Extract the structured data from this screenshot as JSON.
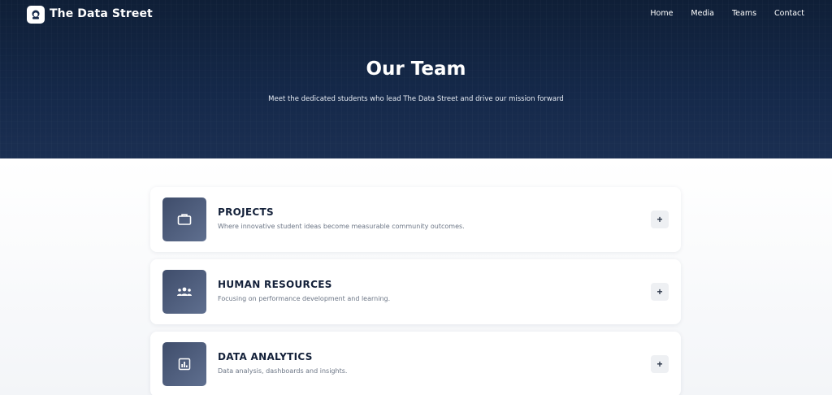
{
  "nav": {
    "brand": "The Data Street",
    "logo_icon": "logo-mascot-icon",
    "links": [
      "Home",
      "Media",
      "Teams",
      "Contact"
    ]
  },
  "hero": {
    "title": "Our Team",
    "subtitle": "Meet the dedicated students who lead The Data Street and drive our mission forward"
  },
  "teams": [
    {
      "title": "PROJECTS",
      "description": "Where innovative student ideas become measurable community outcomes.",
      "icon": "briefcase-icon",
      "expand_label": "+"
    },
    {
      "title": "HUMAN RESOURCES",
      "description": "Focusing on performance development and learning.",
      "icon": "people-group-icon",
      "expand_label": "+"
    },
    {
      "title": "DATA ANALYTICS",
      "description": "Data analysis, dashboards and insights.",
      "icon": "bar-chart-icon",
      "expand_label": "+"
    }
  ],
  "colors": {
    "hero_bg": "#15294a",
    "card_icon_bg": "#4f5d7b",
    "title_text": "#14213a"
  }
}
